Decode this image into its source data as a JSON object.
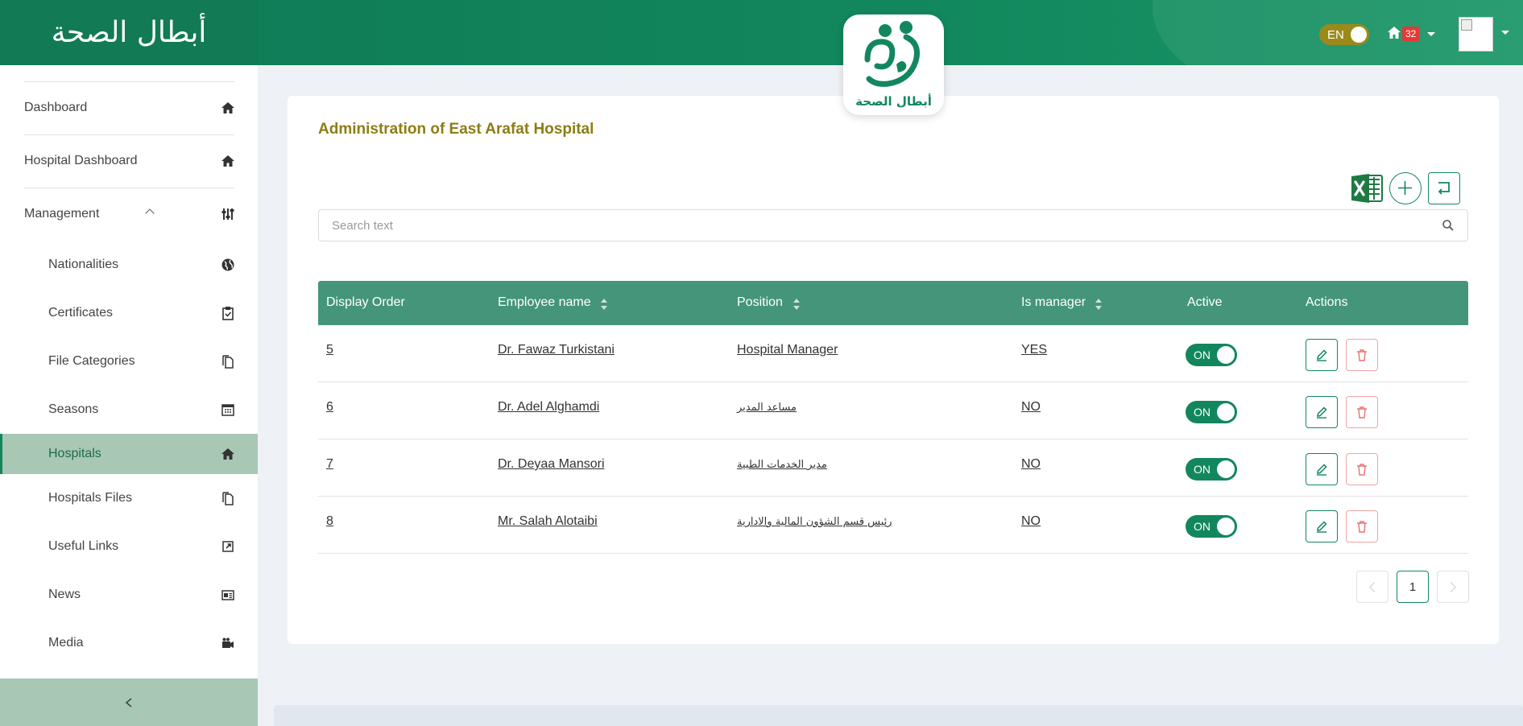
{
  "brand": {
    "logo_text": "أبطال الصحة",
    "center_logo_text": "أبطال الصحة"
  },
  "header": {
    "lang_label": "EN",
    "notification_count": "32"
  },
  "sidebar": {
    "items": [
      {
        "label": "Dashboard",
        "icon": "home-icon"
      },
      {
        "label": "Hospital Dashboard",
        "icon": "home-icon"
      },
      {
        "label": "Management",
        "icon": "sliders-icon"
      },
      {
        "label": "Nationalities",
        "icon": "globe-icon"
      },
      {
        "label": "Certificates",
        "icon": "clipboard-check-icon"
      },
      {
        "label": "File Categories",
        "icon": "files-icon"
      },
      {
        "label": "Seasons",
        "icon": "calendar-icon"
      },
      {
        "label": "Hospitals",
        "icon": "home-icon"
      },
      {
        "label": "Hospitals Files",
        "icon": "files-icon"
      },
      {
        "label": "Useful Links",
        "icon": "external-link-icon"
      },
      {
        "label": "News",
        "icon": "newspaper-icon"
      },
      {
        "label": "Media",
        "icon": "video-camera-icon"
      }
    ],
    "collapse_icon": "chevron-left-icon"
  },
  "main": {
    "title": "Administration of East Arafat Hospital",
    "search": {
      "placeholder": "Search text",
      "value": ""
    },
    "table": {
      "columns": [
        "Display Order",
        "Employee name",
        "Position",
        "Is manager",
        "Active",
        "Actions"
      ],
      "rows": [
        {
          "order": "5",
          "name": "Dr. Fawaz Turkistani",
          "position": "Hospital Manager",
          "is_manager": "YES",
          "active": "ON"
        },
        {
          "order": "6",
          "name": "Dr. Adel Alghamdi",
          "position": "مساعد المدير",
          "is_manager": "NO",
          "active": "ON"
        },
        {
          "order": "7",
          "name": "Dr. Deyaa Mansori",
          "position": "مدير الخدمات الطبية",
          "is_manager": "NO",
          "active": "ON"
        },
        {
          "order": "8",
          "name": "Mr. Salah Alotaibi",
          "position": "رئيس قسم الشؤون المالية والادارية",
          "is_manager": "NO",
          "active": "ON"
        }
      ]
    },
    "pagination": {
      "current_page": "1"
    }
  },
  "colors": {
    "primary": "#12875d",
    "title_gold": "#8d7d14",
    "table_header": "#44957a",
    "sidebar_active": "#a8c7b4",
    "delete": "#e57373"
  }
}
